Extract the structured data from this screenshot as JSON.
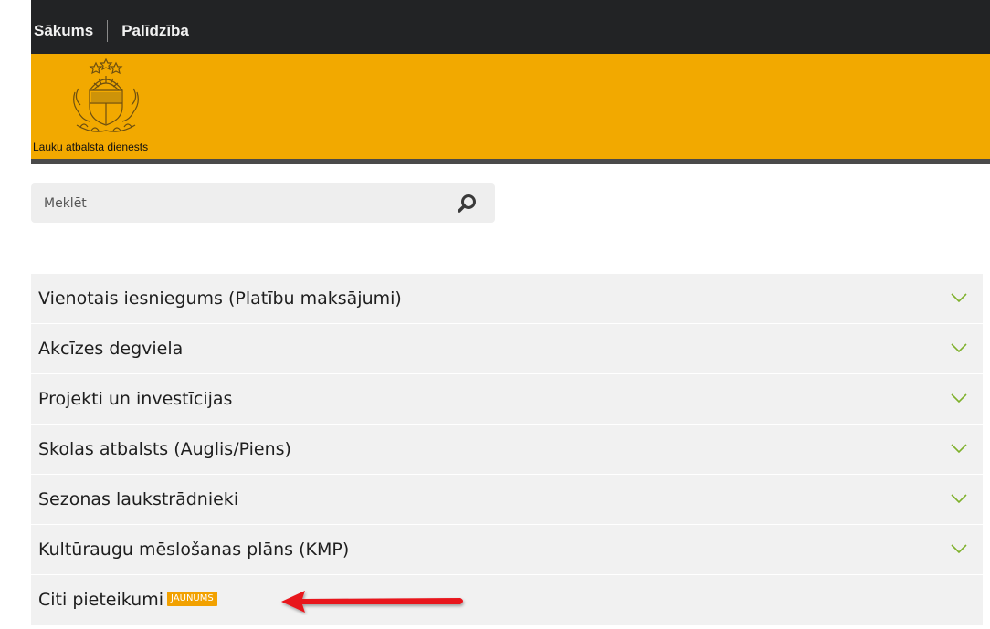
{
  "topnav": {
    "home_label": "Sākums",
    "help_label": "Palīdzība"
  },
  "header": {
    "org_name": "Lauku atbalsta dienests",
    "logo_icon": "latvia-coat-of-arms-icon",
    "brand_color": "#f2a900"
  },
  "search": {
    "placeholder": "Meklēt",
    "value": "",
    "icon": "search-icon"
  },
  "menu": {
    "items": [
      {
        "label": "Vienotais iesniegums (Platību maksājumi)",
        "icon": "chevron-down-icon"
      },
      {
        "label": "Akcīzes degviela",
        "icon": "chevron-down-icon"
      },
      {
        "label": "Projekti un investīcijas",
        "icon": "chevron-down-icon"
      },
      {
        "label": "Skolas atbalsts (Auglis/Piens)",
        "icon": "chevron-down-icon"
      },
      {
        "label": "Sezonas laukstrādnieki",
        "icon": "chevron-down-icon"
      },
      {
        "label": "Kultūraugu mēslošanas plāns (KMP)",
        "icon": "chevron-down-icon"
      }
    ],
    "last_item": {
      "label": "Citi pieteikumi",
      "badge": "JAUNUMS",
      "badge_color": "#f2a100"
    }
  },
  "annotation": {
    "arrow_color": "#e8141c",
    "arrow_icon": "red-arrow-pointer"
  }
}
